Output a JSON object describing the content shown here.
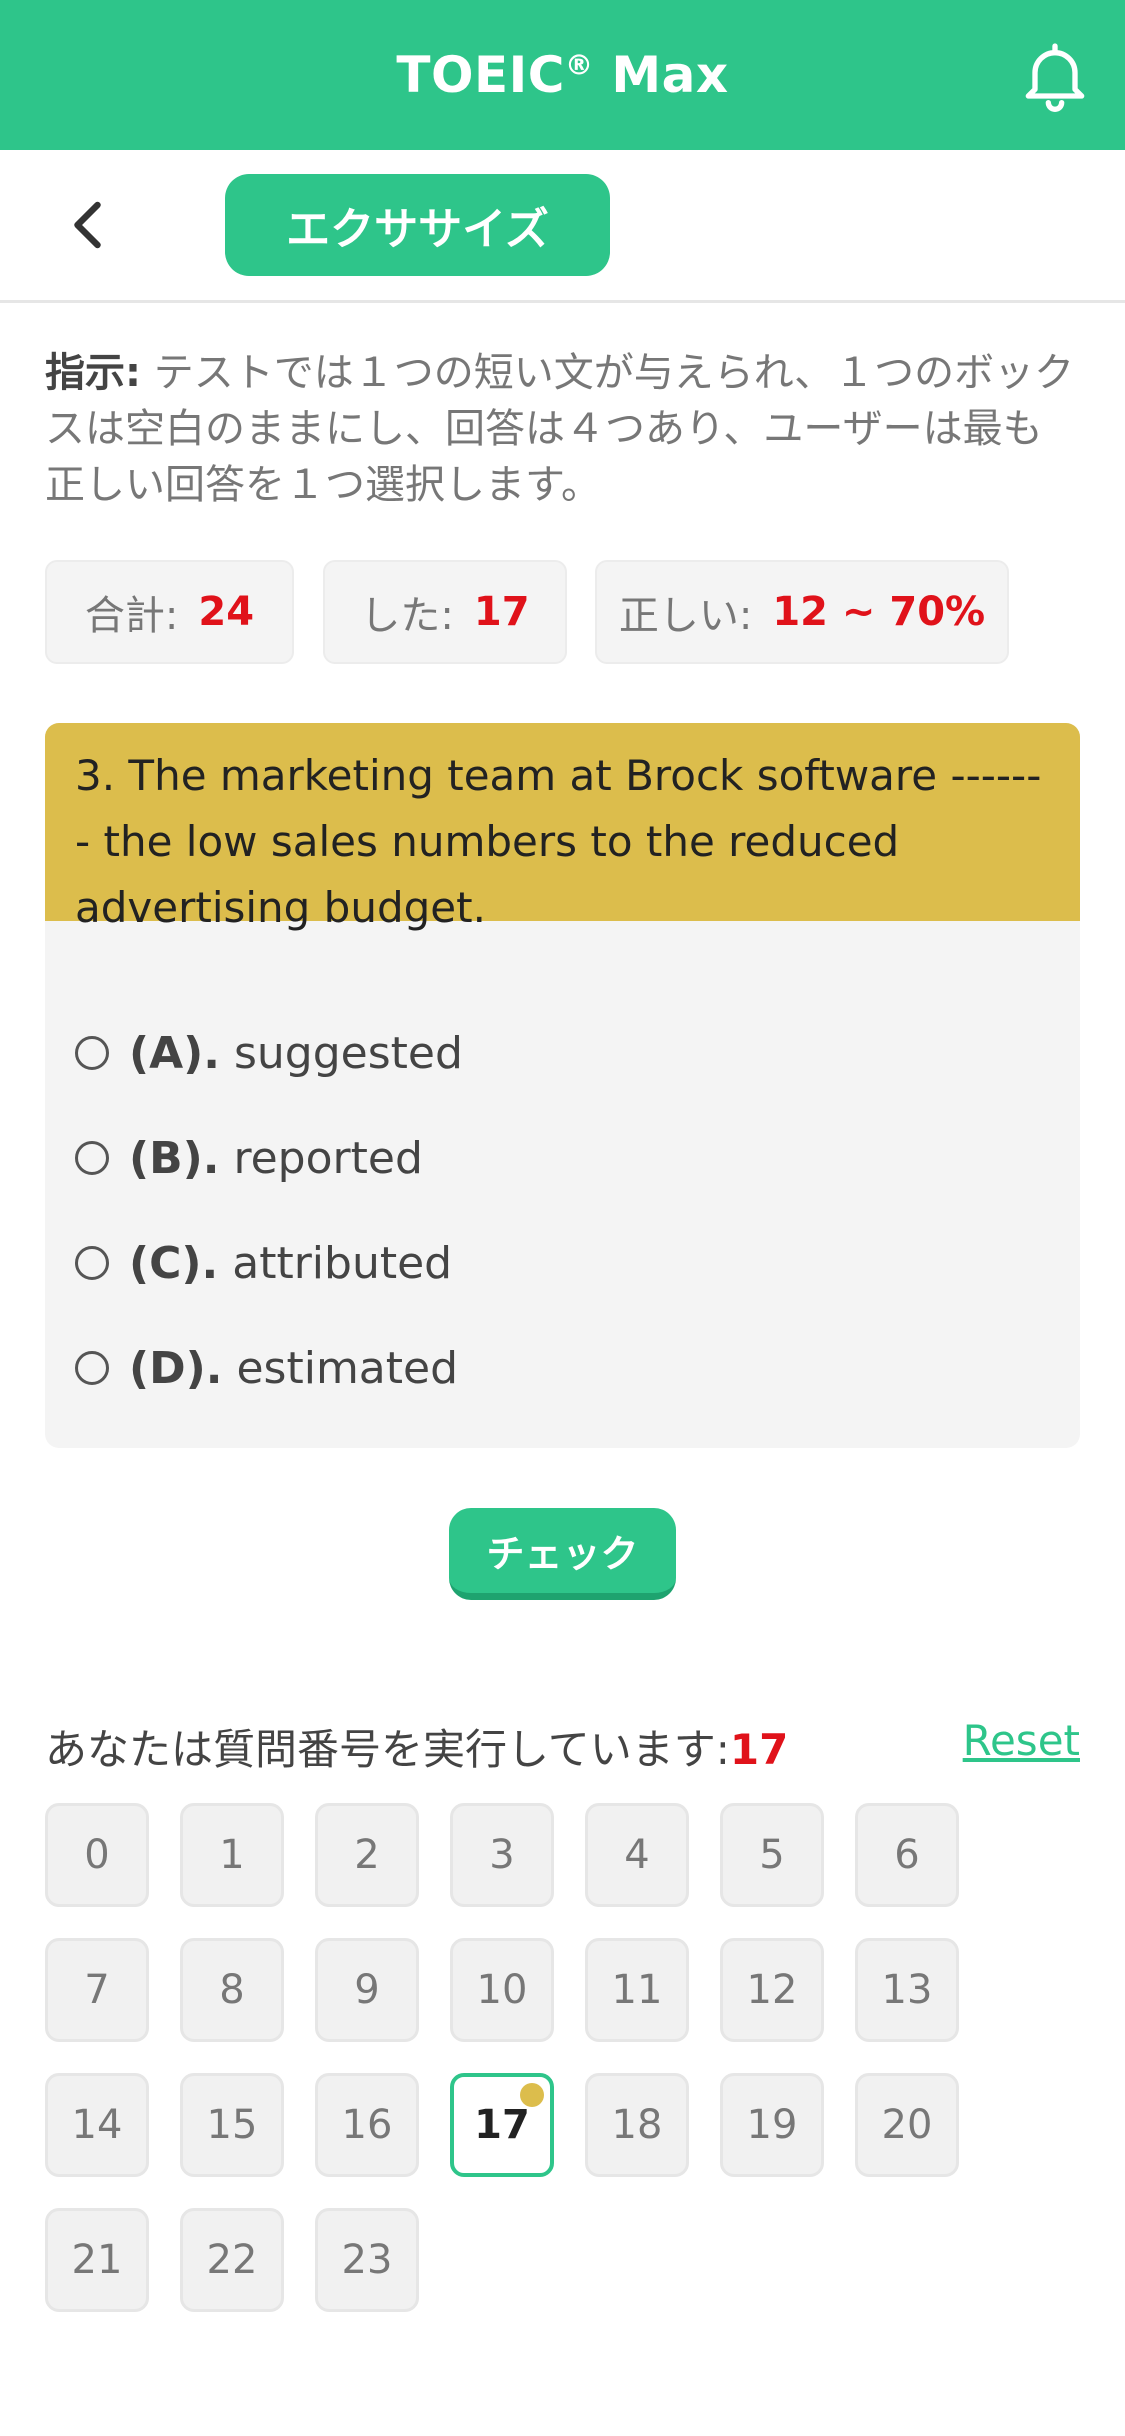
{
  "header": {
    "title": "TOEIC",
    "title_reg": "®",
    "title_suffix": " Max",
    "bell_icon": "bell-icon"
  },
  "subbar": {
    "back_icon": "chevron-left-icon",
    "tab_label": "エクササイズ"
  },
  "instructions": {
    "label": "指示:",
    "text": " テストでは１つの短い文が与えられ、１つのボックスは空白のままにし、回答は４つあり、ユーザーは最も正しい回答を１つ選択します。"
  },
  "stats": {
    "total_label": "合計:",
    "total_value": "24",
    "done_label": "した:",
    "done_value": "17",
    "correct_label": "正しい:",
    "correct_value": "12 ~ 70%"
  },
  "question": {
    "text": "3. The marketing team at Brock software ------- the low sales numbers to the reduced advertising budget.",
    "options": [
      {
        "key": "(A).",
        "text": "suggested"
      },
      {
        "key": "(B).",
        "text": "reported"
      },
      {
        "key": "(C).",
        "text": "attributed"
      },
      {
        "key": "(D).",
        "text": "estimated"
      }
    ]
  },
  "check_label": "チェック",
  "progress": {
    "label": "あなたは質問番号を実行しています:",
    "current": "17",
    "reset_label": "Reset"
  },
  "numbers": [
    "0",
    "1",
    "2",
    "3",
    "4",
    "5",
    "6",
    "7",
    "8",
    "9",
    "10",
    "11",
    "12",
    "13",
    "14",
    "15",
    "16",
    "17",
    "18",
    "19",
    "20",
    "21",
    "22",
    "23"
  ],
  "colors": {
    "brand": "#2ec58a",
    "question_bg": "#dcbd4c",
    "accent_red": "#e0121a"
  }
}
